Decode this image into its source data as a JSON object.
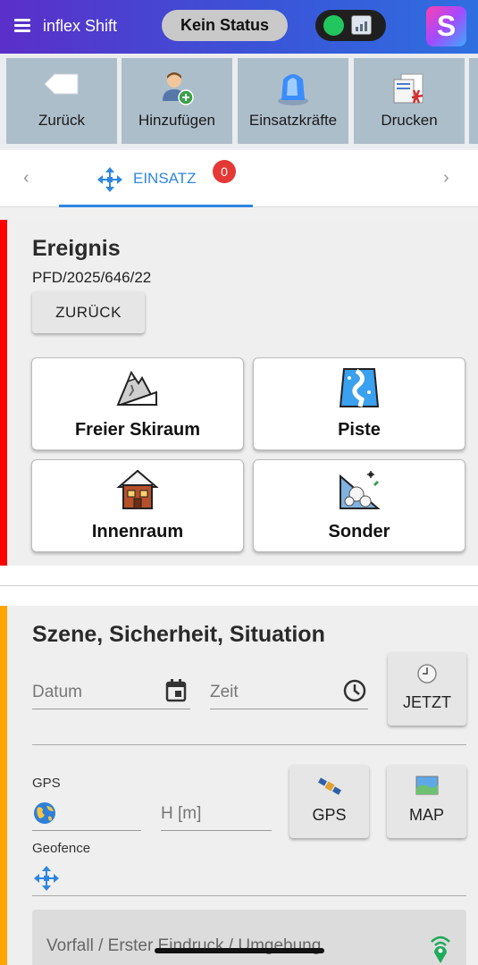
{
  "header": {
    "app_title": "inflex Shift",
    "status": "Kein Status",
    "logo_letter": "S",
    "connection_color": "#22c55e"
  },
  "toolbar": {
    "items": [
      {
        "label": "Zurück",
        "icon": "back-arrow-icon"
      },
      {
        "label": "Hinzufügen",
        "icon": "add-person-icon"
      },
      {
        "label": "Einsatzkräfte",
        "icon": "blue-beacon-icon"
      },
      {
        "label": "Drucken",
        "icon": "print-pdf-icon"
      }
    ]
  },
  "tabs": {
    "active_label": "EINSATZ",
    "badge": "0",
    "prev": "‹",
    "next": "›"
  },
  "ereignis": {
    "title": "Ereignis",
    "id": "PFD/2025/646/22",
    "back_button": "ZURÜCK",
    "categories": [
      {
        "label": "Freier Skiraum",
        "icon": "mountain-icon"
      },
      {
        "label": "Piste",
        "icon": "piste-icon"
      },
      {
        "label": "Innenraum",
        "icon": "hut-icon"
      },
      {
        "label": "Sonder",
        "icon": "avalanche-icon"
      }
    ]
  },
  "szene": {
    "title": "Szene, Sicherheit, Situation",
    "datum_placeholder": "Datum",
    "zeit_placeholder": "Zeit",
    "jetzt_button": "JETZT",
    "gps_label": "GPS",
    "height_placeholder": "H [m]",
    "gps_button": "GPS",
    "map_button": "MAP",
    "geofence_label": "Geofence",
    "vorfall_placeholder": "Vorfall / Erster Eindruck / Umgebung"
  },
  "colors": {
    "accent": "#2f86e0",
    "ereignis_bar": "#ff0000",
    "szene_bar": "#ffa500",
    "badge": "#e53935"
  }
}
